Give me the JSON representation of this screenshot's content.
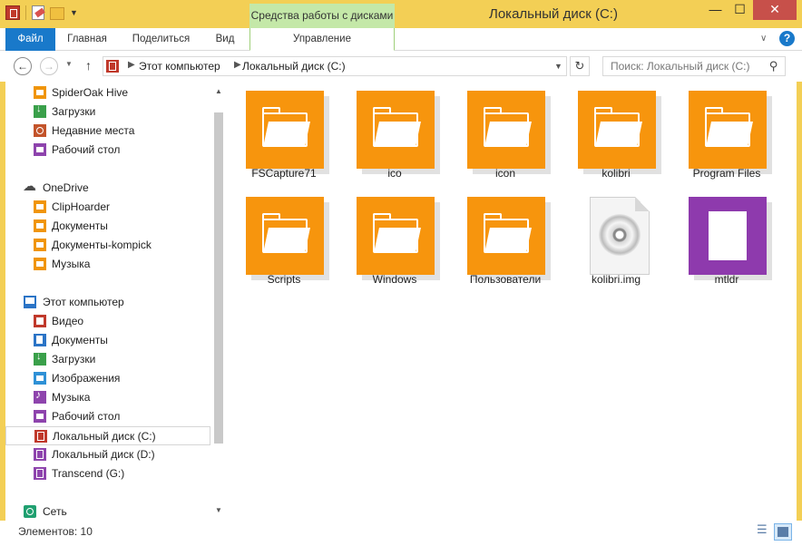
{
  "window": {
    "title": "Локальный диск (C:)",
    "context_group": "Средства работы с дисками",
    "close_glyph": "✕",
    "min_glyph": "—",
    "max_glyph": "☐"
  },
  "ribbon": {
    "tabs": [
      {
        "label": "Файл"
      },
      {
        "label": "Главная"
      },
      {
        "label": "Поделиться"
      },
      {
        "label": "Вид"
      },
      {
        "label": "Управление"
      }
    ],
    "help": "?"
  },
  "address_bar": {
    "crumbs": [
      "Этот компьютер",
      "Локальный диск (C:)"
    ],
    "search_placeholder": "Поиск: Локальный диск (C:)"
  },
  "nav_pane": {
    "items": [
      {
        "label": "SpiderOak Hive",
        "icon": "folder-icon"
      },
      {
        "label": "Загрузки",
        "icon": "downloads-icon"
      },
      {
        "label": "Недавние места",
        "icon": "recent-places-icon"
      },
      {
        "label": "Рабочий стол",
        "icon": "desktop-icon"
      },
      {
        "label": "OneDrive",
        "icon": "onedrive-icon"
      },
      {
        "label": "ClipHoarder",
        "icon": "folder-icon"
      },
      {
        "label": "Документы",
        "icon": "folder-icon"
      },
      {
        "label": "Документы-kompick",
        "icon": "folder-icon"
      },
      {
        "label": "Музыка",
        "icon": "folder-icon"
      },
      {
        "label": "Этот компьютер",
        "icon": "computer-icon"
      },
      {
        "label": "Видео",
        "icon": "videos-icon"
      },
      {
        "label": "Документы",
        "icon": "documents-icon"
      },
      {
        "label": "Загрузки",
        "icon": "downloads-icon"
      },
      {
        "label": "Изображения",
        "icon": "pictures-icon"
      },
      {
        "label": "Музыка",
        "icon": "music-icon"
      },
      {
        "label": "Рабочий стол",
        "icon": "desktop-icon"
      },
      {
        "label": "Локальный диск (C:)",
        "icon": "drive-icon",
        "selected": true
      },
      {
        "label": "Локальный диск (D:)",
        "icon": "drive-icon"
      },
      {
        "label": "Transcend (G:)",
        "icon": "drive-icon"
      },
      {
        "label": "Сеть",
        "icon": "network-icon"
      }
    ]
  },
  "content": {
    "items": [
      {
        "label": "FSCapture71",
        "type": "folder"
      },
      {
        "label": "ico",
        "type": "folder"
      },
      {
        "label": "icon",
        "type": "folder"
      },
      {
        "label": "kolibri",
        "type": "folder"
      },
      {
        "label": "Program Files",
        "type": "folder"
      },
      {
        "label": "Scripts",
        "type": "folder"
      },
      {
        "label": "Windows",
        "type": "folder"
      },
      {
        "label": "Пользователи",
        "type": "folder"
      },
      {
        "label": "kolibri.img",
        "type": "disc-image"
      },
      {
        "label": "mtldr",
        "type": "file"
      }
    ]
  },
  "status_bar": {
    "items_count": "Элементов: 10"
  },
  "colors": {
    "titlebar": "#f3cf55",
    "file_tab": "#1979ca",
    "context_tab": "#c4e8a8",
    "folder_tile": "#f7950d",
    "file_tile": "#8e3aad"
  }
}
